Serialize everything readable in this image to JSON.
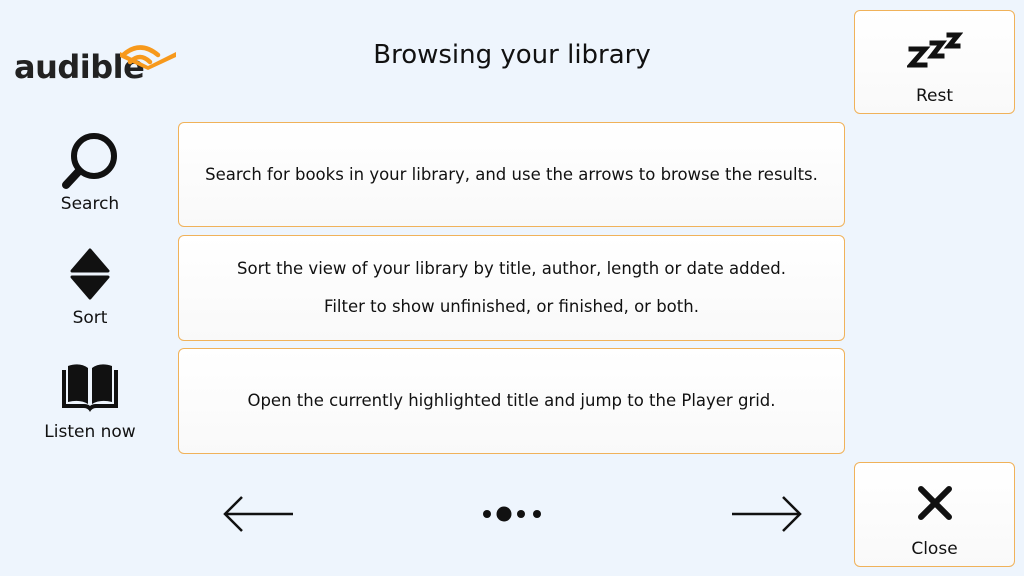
{
  "header": {
    "logo_text": "audible",
    "title": "Browsing your library"
  },
  "rest_button": {
    "label": "Rest",
    "icon": "zzz-icon"
  },
  "close_button": {
    "label": "Close",
    "icon": "close-icon"
  },
  "items": [
    {
      "label": "Search",
      "icon": "search-icon",
      "lines": [
        "Search for books in your library, and use the arrows to browse the results."
      ]
    },
    {
      "label": "Sort",
      "icon": "sort-icon",
      "lines": [
        "Sort the view of your library by title, author, length or date added.",
        "Filter to show unfinished, or finished, or both."
      ]
    },
    {
      "label": "Listen now",
      "icon": "book-icon",
      "lines": [
        "Open the currently highlighted title and jump to the Player grid."
      ]
    }
  ],
  "pager": {
    "pages": 4,
    "current": 2
  },
  "colors": {
    "accent_border": "#f0b25a",
    "logo_orange": "#f7991c",
    "background": "#eef5fd"
  }
}
